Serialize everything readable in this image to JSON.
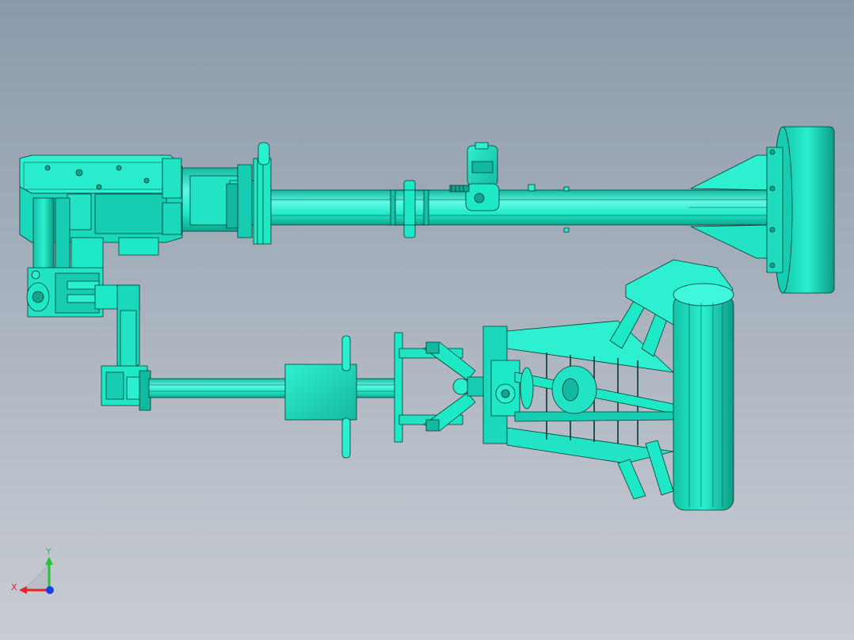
{
  "viewport": {
    "background_top": "#8b9aab",
    "background_bottom": "#c9cdd3",
    "model_fill": "#1de9c6",
    "model_light": "#3ff7dc",
    "model_shadow": "#12b9a0",
    "edge_color": "#05382f"
  },
  "triad": {
    "x_label": "X",
    "y_label": "Y",
    "x_color": "#e8202a",
    "y_color": "#22c33a",
    "z_color": "#1a3fe0"
  }
}
